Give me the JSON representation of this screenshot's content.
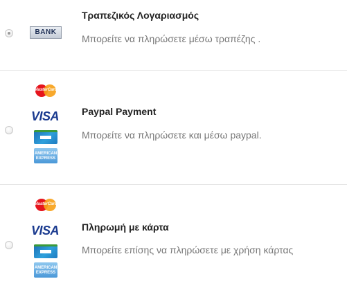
{
  "payment_methods": [
    {
      "title": "Τραπεζικός Λογαριασμός",
      "description": "Μπορείτε να πληρώσετε μέσω τραπέζης .",
      "selected": true,
      "logos": [
        "bank-logo"
      ],
      "bank_logo_text": "BANK"
    },
    {
      "title": "Paypal Payment",
      "description": "Μπορείτε να πληρώσετε και μέσω paypal.",
      "selected": false,
      "logos": [
        "mastercard-logo",
        "visa-logo",
        "cb-logo",
        "amex-logo"
      ]
    },
    {
      "title": "Πληρωμή με κάρτα",
      "description": "Μπορείτε επίσης να πληρώσετε με χρήση κάρτας",
      "selected": false,
      "logos": [
        "mastercard-logo",
        "visa-logo",
        "cb-logo",
        "amex-logo"
      ]
    }
  ],
  "logo_text": {
    "mastercard": "MasterCard",
    "visa": "VISA",
    "amex_line1": "AMERICAN",
    "amex_line2": "EXPRESS"
  },
  "colors": {
    "title": "#222222",
    "description": "#777777",
    "divider": "#e6e6e6",
    "visa_blue": "#1a3a8f"
  }
}
